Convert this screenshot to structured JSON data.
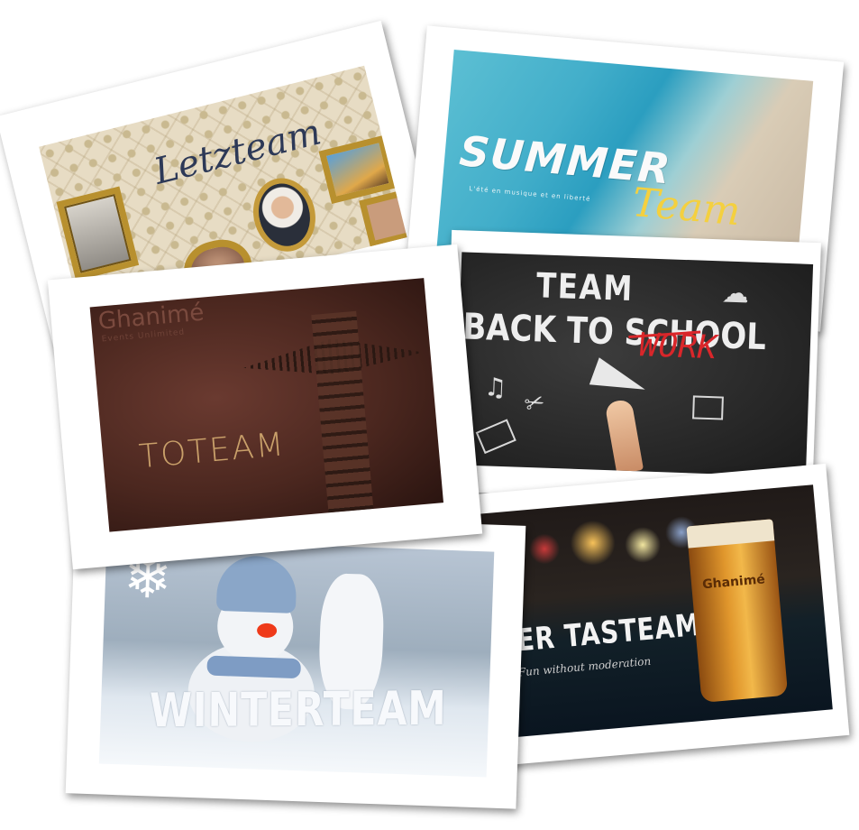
{
  "cards": {
    "letzteam": {
      "title": "Letzteam"
    },
    "summer": {
      "word1": "SUMMER",
      "word2": "Team",
      "tagline": "L'été en musique et en liberté"
    },
    "toteam": {
      "brand": "Ghanimé",
      "brand_sub": "Events Unlimited",
      "title": "TOTEAM"
    },
    "school": {
      "line1": "TEAM",
      "line2": "BACK TO SCHOOL",
      "replacement": "WORK"
    },
    "winter": {
      "title": "WINTERTEAM"
    },
    "beer": {
      "title": "BEER TASTEAM",
      "subtitle": "Fun without moderation",
      "glass_brand": "Ghanimé"
    }
  },
  "colors": {
    "summer_accent": "#f4d03f",
    "school_red": "#d9262a",
    "toteam_gold": "#c9a06a"
  }
}
